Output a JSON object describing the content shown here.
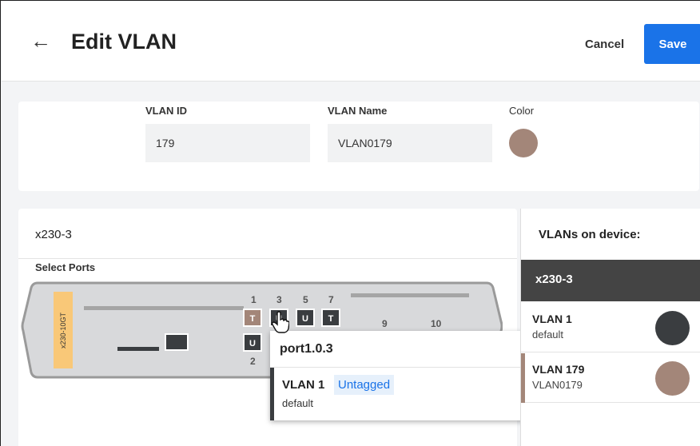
{
  "header": {
    "back_icon": "arrow-left-icon",
    "title": "Edit VLAN",
    "cancel_label": "Cancel",
    "save_label": "Save"
  },
  "form": {
    "vlan_id_label": "VLAN ID",
    "vlan_id_value": "179",
    "vlan_name_label": "VLAN Name",
    "vlan_name_value": "VLAN0179",
    "color_label": "Color",
    "color_value": "#a38679"
  },
  "device": {
    "hostname": "x230-3",
    "select_ports_label": "Select Ports",
    "model": "x230-10GT",
    "port_numbers": [
      "1",
      "3",
      "5",
      "7",
      "9",
      "10",
      "2"
    ],
    "ports": [
      {
        "label": "T",
        "mode": "tagged"
      },
      {
        "label": "U",
        "mode": "untagged"
      },
      {
        "label": "U",
        "mode": "untagged"
      },
      {
        "label": "T",
        "mode": "tagged"
      },
      {
        "label": "U",
        "mode": "untagged"
      }
    ]
  },
  "tooltip": {
    "port": "port1.0.3",
    "vlan": "VLAN 1",
    "mode": "Untagged",
    "desc": "default"
  },
  "vlans_panel": {
    "title": "VLANs on device:",
    "device": "x230-3",
    "vlans": [
      {
        "name": "VLAN 1",
        "desc": "default",
        "color": "#3a3d40"
      },
      {
        "name": "VLAN 179",
        "desc": "VLAN0179",
        "color": "#a38679"
      }
    ]
  },
  "colors": {
    "accent": "#1a73e8",
    "vlan_color": "#a38679",
    "dark": "#3a3d40"
  }
}
